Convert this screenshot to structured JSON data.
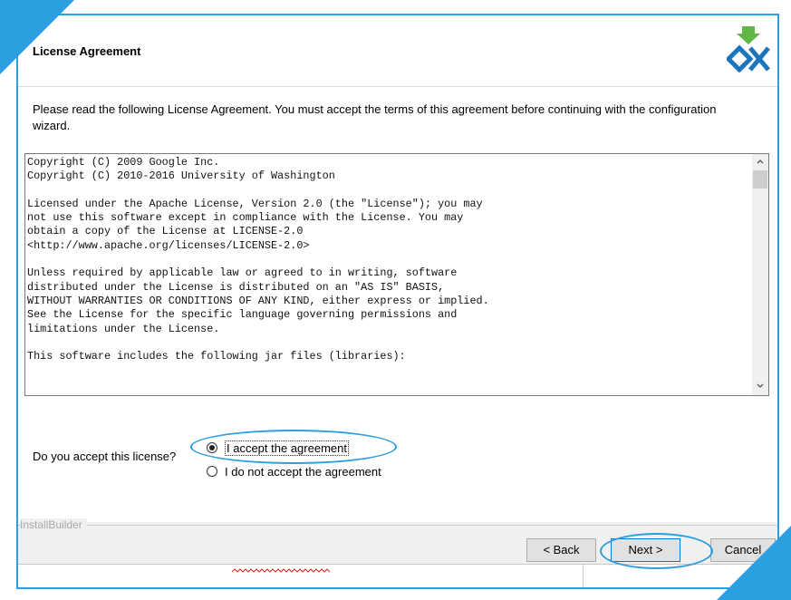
{
  "header": {
    "title": "License Agreement"
  },
  "intro_text": "Please read the following License Agreement. You must accept the terms of this agreement before continuing with the configuration wizard.",
  "license_lines": [
    "Copyright (C) 2009 Google Inc.",
    "Copyright (C) 2010-2016 University of Washington",
    "",
    "Licensed under the Apache License, Version 2.0 (the \"License\"); you may",
    "not use this software except in compliance with the License. You may",
    "obtain a copy of the License at LICENSE-2.0",
    "<http://www.apache.org/licenses/LICENSE-2.0>",
    "",
    "Unless required by applicable law or agreed to in writing, software",
    "distributed under the License is distributed on an \"AS IS\" BASIS,",
    "WITHOUT WARRANTIES OR CONDITIONS OF ANY KIND, either express or implied.",
    "See the License for the specific language governing permissions and",
    "limitations under the License.",
    "",
    "This software includes the following jar files (libraries):"
  ],
  "question": "Do you accept this license?",
  "options": {
    "accept": "I accept the agreement",
    "decline": "I do not accept the agreement",
    "selected": "accept"
  },
  "brand": "InstallBuilder",
  "buttons": {
    "back": "< Back",
    "next": "Next >",
    "cancel": "Cancel"
  },
  "icons": {
    "logo": "installbuilder-logo-icon",
    "scroll_up": "chevron-up-icon",
    "scroll_down": "chevron-down-icon"
  },
  "colors": {
    "annotation": "#2b9fe0",
    "logo_blue": "#1b75bc",
    "logo_green": "#5fb846"
  }
}
